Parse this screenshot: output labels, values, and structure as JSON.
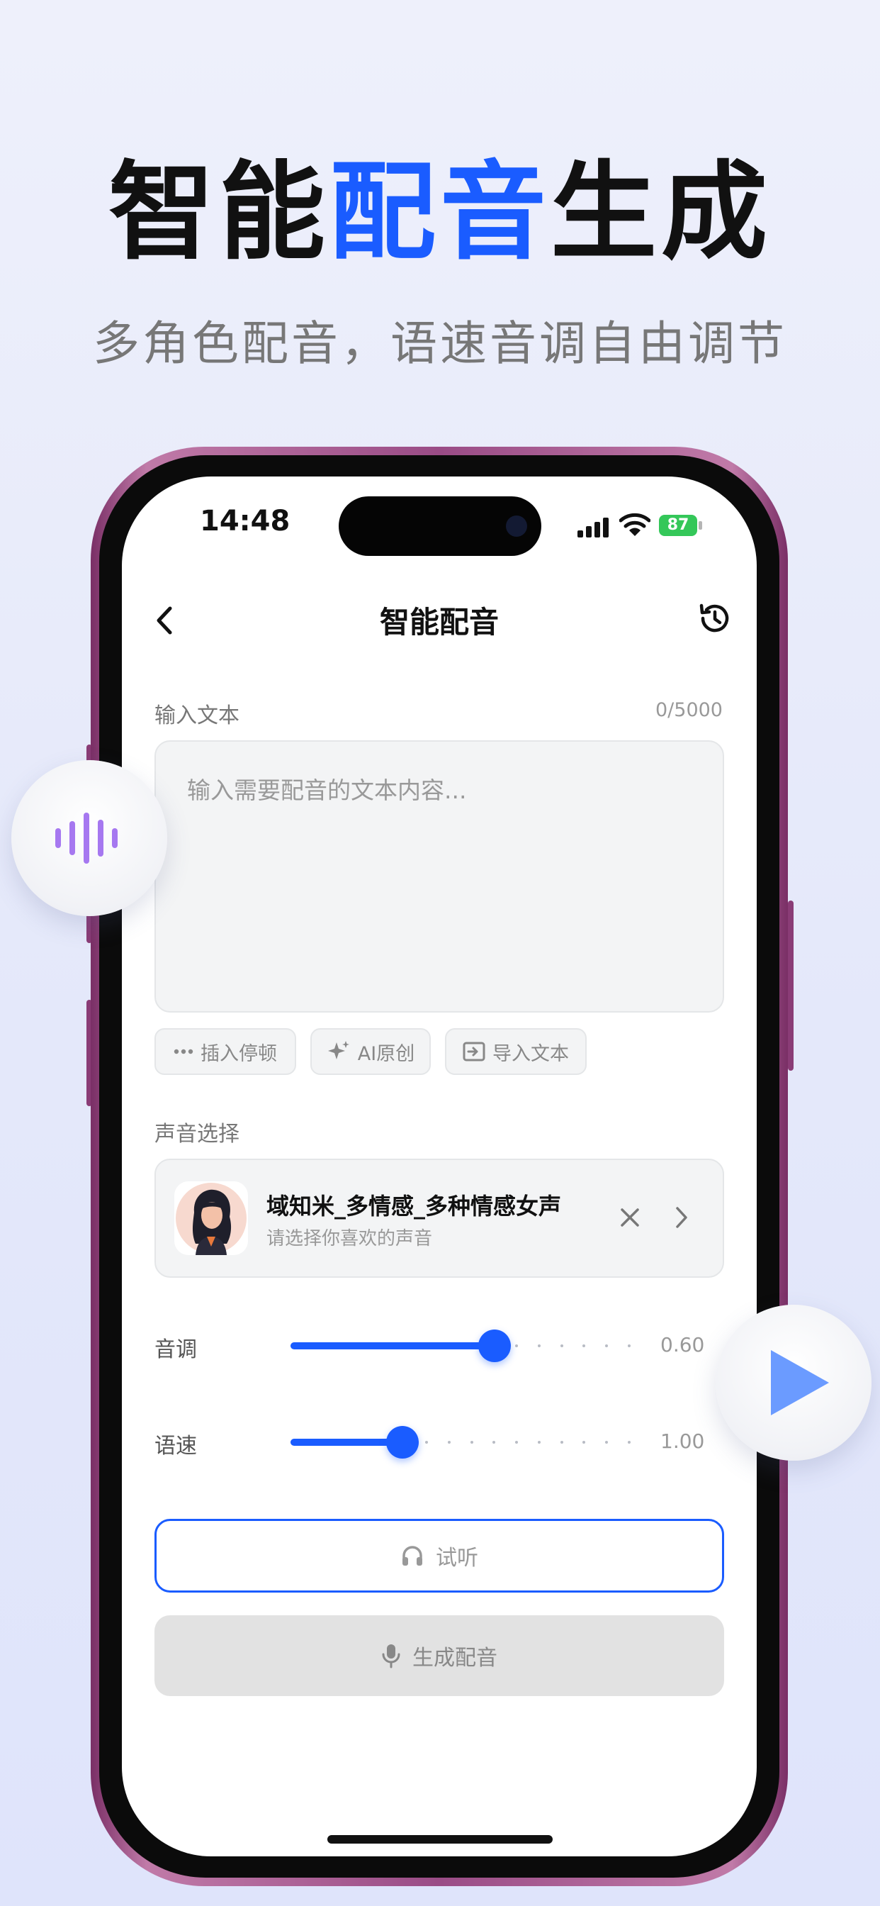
{
  "headline": {
    "part1": "智能",
    "highlight": "配音",
    "part2": "生成"
  },
  "subline": "多角色配音，语速音调自由调节",
  "status_bar": {
    "time": "14:48",
    "battery": "87"
  },
  "nav": {
    "title": "智能配音",
    "back_icon": "chevron-left-icon",
    "history_icon": "history-icon"
  },
  "input": {
    "label": "输入文本",
    "counter": "0/5000",
    "placeholder": "输入需要配音的文本内容..."
  },
  "chips": [
    {
      "label": "插入停顿",
      "icon": "ellipsis-icon"
    },
    {
      "label": "AI原创",
      "icon": "sparkle-icon"
    },
    {
      "label": "导入文本",
      "icon": "import-icon"
    }
  ],
  "voice": {
    "section_label": "声音选择",
    "name": "域知米_多情感_多种情感女声",
    "hint": "请选择你喜欢的声音"
  },
  "sliders": {
    "pitch": {
      "label": "音调",
      "value_text": "0.60",
      "fill_fraction": 0.6
    },
    "speed": {
      "label": "语速",
      "value_text": "1.00",
      "fill_fraction": 0.33
    }
  },
  "buttons": {
    "listen": "试听",
    "generate": "生成配音"
  },
  "colors": {
    "accent": "#1a5cff",
    "wave_icon": "#a678f0",
    "play_icon": "#6b9bff"
  }
}
